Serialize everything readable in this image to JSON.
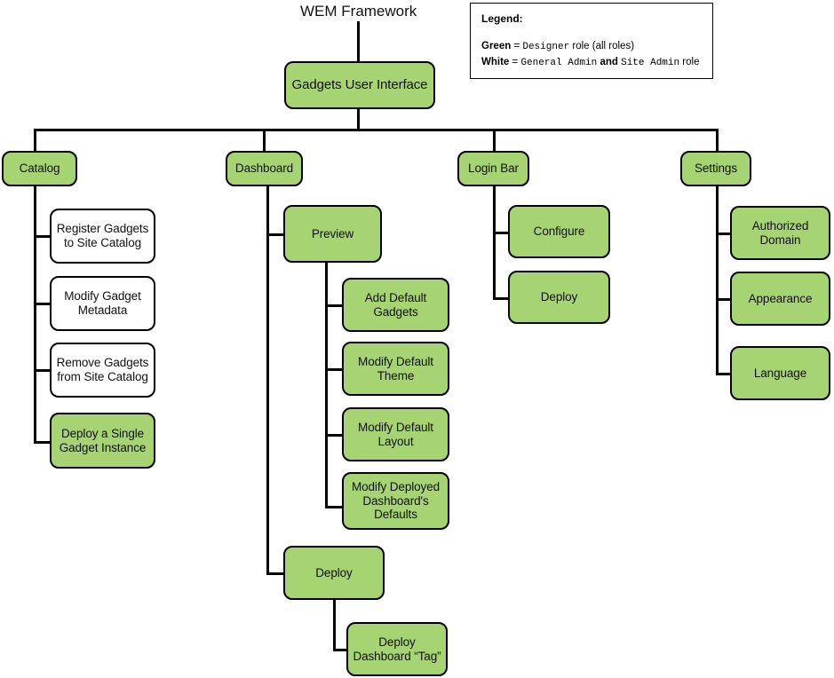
{
  "diagram": {
    "root_title": "WEM Framework",
    "root_node": {
      "label": "Gadgets User Interface",
      "role": "green"
    }
  },
  "legend": {
    "title": "Legend:",
    "rows": [
      {
        "key": "Green",
        "eq": " = ",
        "role_a": "Designer",
        "mid": " role (all roles)",
        "role_b": "",
        "tail": ""
      },
      {
        "key": "White",
        "eq": " = ",
        "role_a": "General Admin",
        "mid": " and ",
        "role_b": "Site Admin",
        "tail": " role"
      }
    ]
  },
  "branches": [
    {
      "label": "Catalog",
      "role": "green",
      "children": [
        {
          "label": "Register Gadgets to Site Catalog",
          "role": "white"
        },
        {
          "label": "Modify Gadget Metadata",
          "role": "white"
        },
        {
          "label": "Remove Gadgets from Site Catalog",
          "role": "white"
        },
        {
          "label": "Deploy a Single Gadget Instance",
          "role": "green"
        }
      ]
    },
    {
      "label": "Dashboard",
      "role": "green",
      "children": [
        {
          "label": "Preview",
          "role": "green",
          "children": [
            {
              "label": "Add Default Gadgets",
              "role": "green"
            },
            {
              "label": "Modify Default Theme",
              "role": "green"
            },
            {
              "label": "Modify Default Layout",
              "role": "green"
            },
            {
              "label": "Modify Deployed Dashboard's Defaults",
              "role": "green"
            }
          ]
        },
        {
          "label": "Deploy",
          "role": "green",
          "children": [
            {
              "label": "Deploy Dashboard “Tag”",
              "role": "green"
            }
          ]
        }
      ]
    },
    {
      "label": "Login Bar",
      "role": "green",
      "children": [
        {
          "label": "Configure",
          "role": "green"
        },
        {
          "label": "Deploy",
          "role": "green"
        }
      ]
    },
    {
      "label": "Settings",
      "role": "green",
      "children": [
        {
          "label": "Authorized Domain",
          "role": "green"
        },
        {
          "label": "Appearance",
          "role": "green"
        },
        {
          "label": "Language",
          "role": "green"
        }
      ]
    }
  ],
  "colors": {
    "green": "#a6d472",
    "white": "#ffffff",
    "stroke": "#000000"
  }
}
